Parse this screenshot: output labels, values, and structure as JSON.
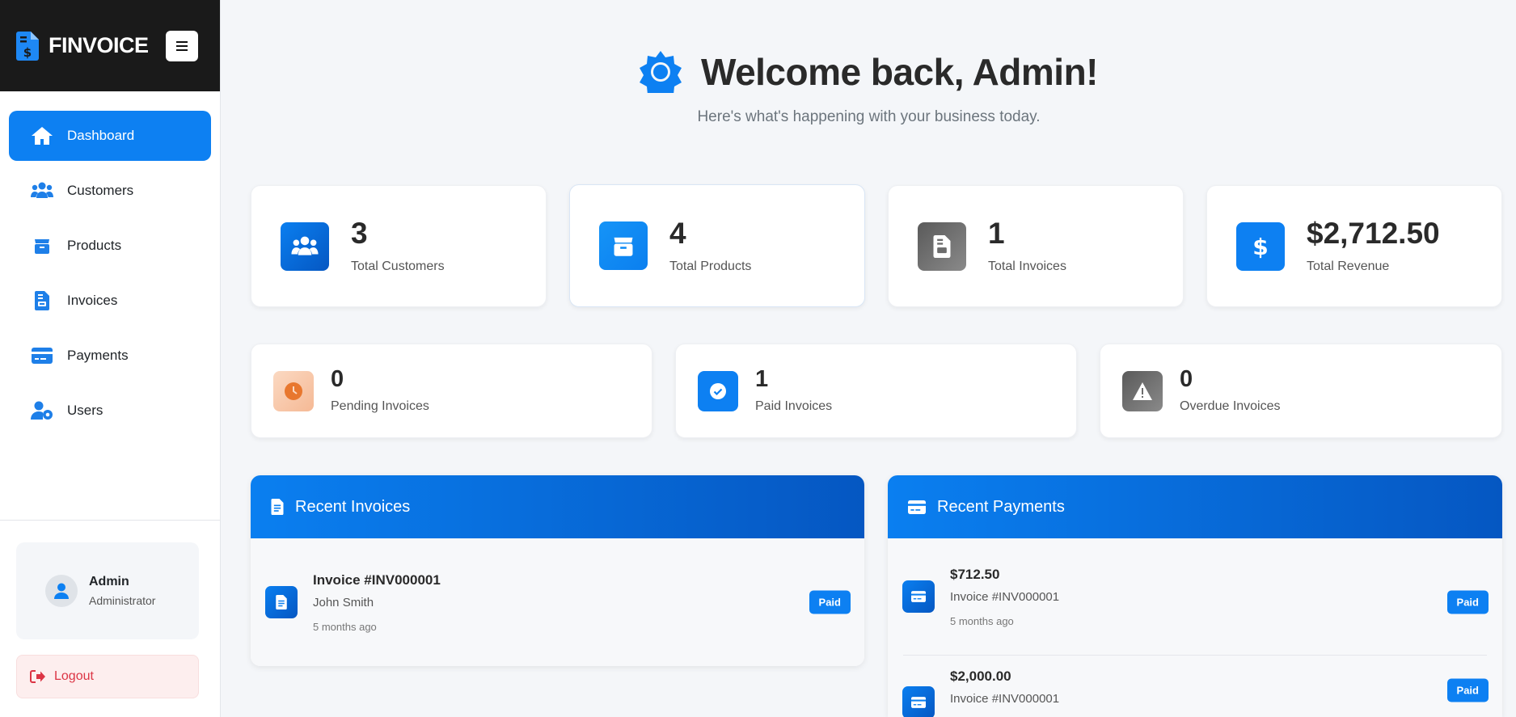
{
  "brand": {
    "name": "FINVOICE"
  },
  "sidebar": {
    "items": [
      {
        "label": "Dashboard",
        "icon": "home-icon",
        "active": true
      },
      {
        "label": "Customers",
        "icon": "users-icon"
      },
      {
        "label": "Products",
        "icon": "box-icon"
      },
      {
        "label": "Invoices",
        "icon": "invoice-icon"
      },
      {
        "label": "Payments",
        "icon": "credit-card-icon"
      },
      {
        "label": "Users",
        "icon": "user-cog-icon"
      }
    ],
    "user": {
      "name": "Admin",
      "role": "Administrator"
    },
    "logout_label": "Logout"
  },
  "hero": {
    "title": "Welcome back, Admin!",
    "subtitle": "Here's what's happening with your business today."
  },
  "stats": [
    {
      "value": "3",
      "label": "Total Customers",
      "icon": "users-icon",
      "color": "#0a6fe0"
    },
    {
      "value": "4",
      "label": "Total Products",
      "icon": "box-icon",
      "color": "#0d8af5"
    },
    {
      "value": "1",
      "label": "Total Invoices",
      "icon": "invoice-icon",
      "color": "#6c6c6c"
    },
    {
      "value": "$2,712.50",
      "label": "Total Revenue",
      "icon": "dollar-icon",
      "color": "#0d80f2"
    }
  ],
  "invoice_stats": [
    {
      "value": "0",
      "label": "Pending Invoices",
      "icon": "clock-icon",
      "color": "#f7c9a8"
    },
    {
      "value": "1",
      "label": "Paid Invoices",
      "icon": "check-icon",
      "color": "#0d80f2"
    },
    {
      "value": "0",
      "label": "Overdue Invoices",
      "icon": "warning-icon",
      "color": "#6c6c6c"
    }
  ],
  "recent_invoices": {
    "title": "Recent Invoices",
    "items": [
      {
        "title": "Invoice #INV000001",
        "customer": "John Smith",
        "time": "5 months ago",
        "status": "Paid"
      }
    ]
  },
  "recent_payments": {
    "title": "Recent Payments",
    "items": [
      {
        "amount": "$712.50",
        "invoice": "Invoice #INV000001",
        "time": "5 months ago",
        "status": "Paid"
      },
      {
        "amount": "$2,000.00",
        "invoice": "Invoice #INV000001",
        "status": "Paid"
      }
    ]
  }
}
